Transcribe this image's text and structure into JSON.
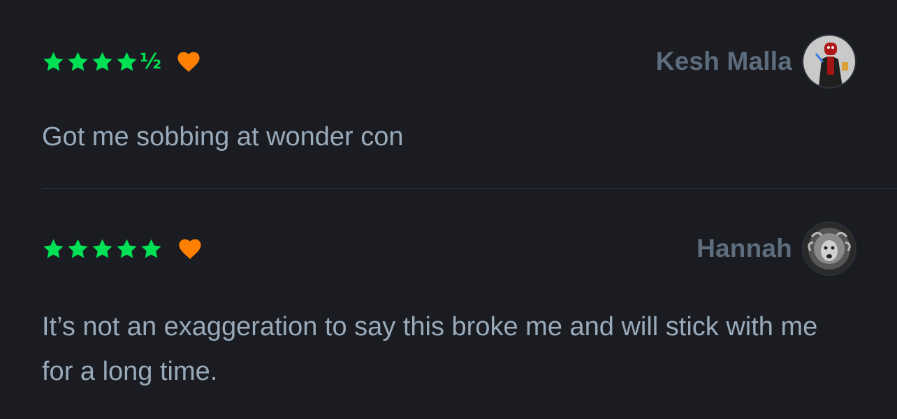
{
  "colors": {
    "background": "#1a1c21",
    "star_green": "#00e054",
    "heart_orange": "#ff8000",
    "username": "#5d6d7d",
    "body_text": "#99aabb",
    "divider": "#333a44"
  },
  "reviews": [
    {
      "rating_stars": 4.5,
      "half_glyph": "½",
      "liked": true,
      "username": "Kesh Malla",
      "avatar_icon": "spider-man-avatar",
      "text": "Got me sobbing at wonder con"
    },
    {
      "rating_stars": 5,
      "liked": true,
      "username": "Hannah",
      "avatar_icon": "medusa-avatar",
      "text": "It’s not an exaggeration to say this broke me and will stick with me for a long time."
    }
  ]
}
